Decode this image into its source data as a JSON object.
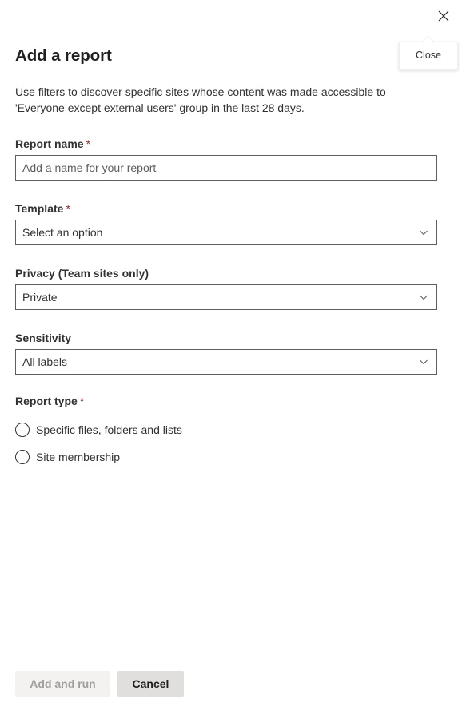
{
  "panel": {
    "title": "Add a report",
    "description": "Use filters to discover specific sites whose content was made accessible to 'Everyone except external users' group in the last 28 days.",
    "close_label": "Close",
    "close_tooltip": "Close"
  },
  "fields": {
    "report_name": {
      "label": "Report name",
      "required_marker": "*",
      "value": "",
      "placeholder": "Add a name for your report"
    },
    "template": {
      "label": "Template",
      "required_marker": "*",
      "value": "Select an option",
      "chevron": "chevron-down-icon"
    },
    "privacy": {
      "label": "Privacy (Team sites only)",
      "value": "Private",
      "chevron": "chevron-down-icon"
    },
    "sensitivity": {
      "label": "Sensitivity",
      "value": "All labels",
      "chevron": "chevron-down-icon"
    },
    "report_type": {
      "label": "Report type",
      "required_marker": "*",
      "options": [
        {
          "label": "Specific files, folders and lists",
          "selected": false
        },
        {
          "label": "Site membership",
          "selected": false
        }
      ]
    }
  },
  "footer": {
    "submit_label": "Add and run",
    "submit_disabled": true,
    "cancel_label": "Cancel"
  },
  "colors": {
    "required_asterisk": "#a4262c",
    "text_primary": "#323130",
    "title": "#201f1e",
    "border": "#605e5c",
    "button_default_bg": "#e1dfdd",
    "button_disabled_bg": "#f3f2f1",
    "button_disabled_text": "#a19f9d"
  }
}
